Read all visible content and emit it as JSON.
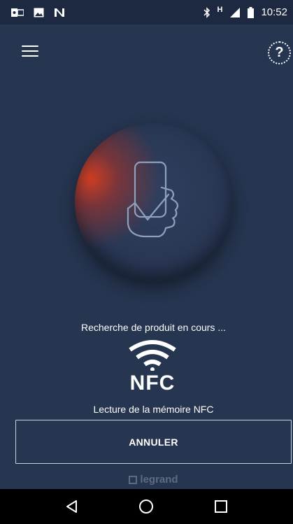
{
  "status_bar": {
    "time": "10:52",
    "network_label": "H",
    "left_icons": [
      "outlook-icon",
      "image-icon",
      "n-app-icon"
    ],
    "right_icons": [
      "bluetooth-icon",
      "signal-icon",
      "battery-icon"
    ]
  },
  "header": {
    "menu_icon": "hamburger-menu-icon",
    "help_label": "?"
  },
  "scan": {
    "status_text": "Recherche de produit en cours ...",
    "nfc_label": "NFC",
    "reading_text": "Lecture de la mémoire NFC"
  },
  "actions": {
    "cancel_label": "ANNULER"
  },
  "footer": {
    "brand": "legrand"
  },
  "nav": {
    "back": "back-icon",
    "home": "home-icon",
    "recents": "recents-icon"
  },
  "colors": {
    "background": "#263550",
    "status_bar": "#1c2940",
    "accent_glow": "#d63e20",
    "nav_bar": "#000000"
  }
}
